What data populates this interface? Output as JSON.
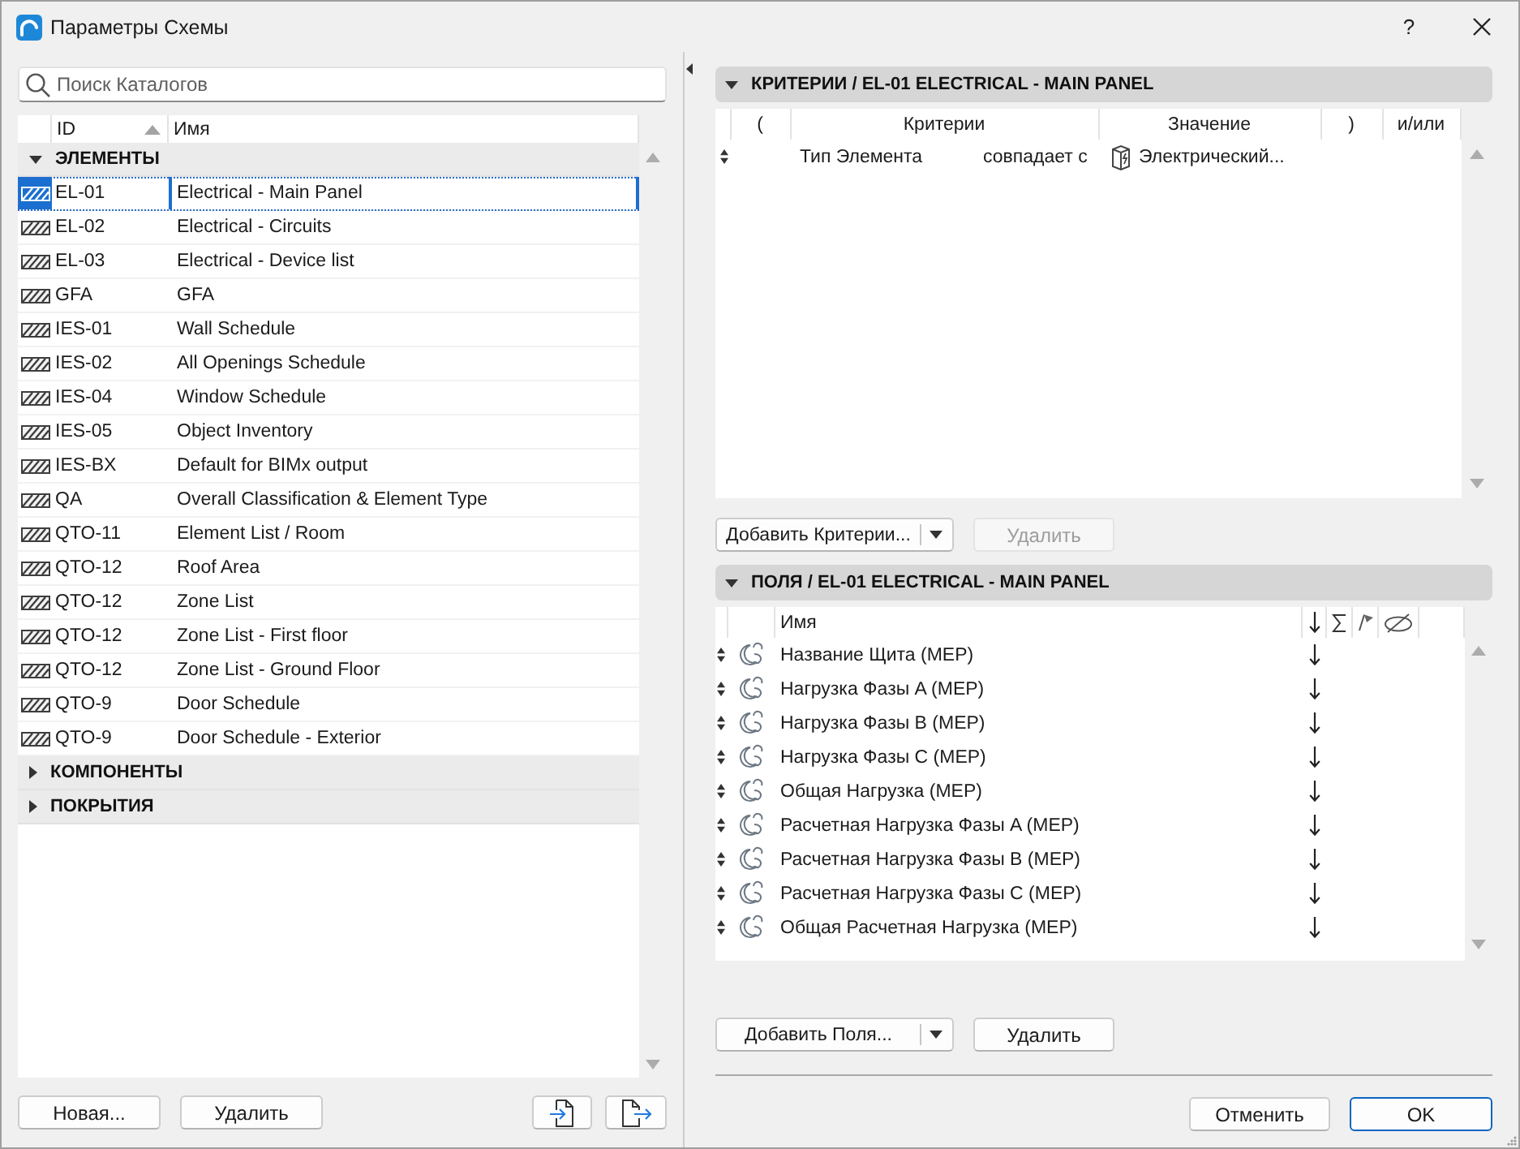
{
  "window": {
    "title": "Параметры Схемы",
    "help_button": "?"
  },
  "catalog": {
    "search": {
      "placeholder": "Поиск Каталогов"
    },
    "columns": [
      {
        "label": "ID",
        "sorted": true
      },
      {
        "label": "Имя",
        "sorted": false
      }
    ],
    "groups": [
      {
        "label": "ЭЛЕМЕНТЫ",
        "expanded": true,
        "items": [
          {
            "id": "EL-01",
            "name": "Electrical - Main Panel",
            "selected": true
          },
          {
            "id": "EL-02",
            "name": "Electrical - Circuits",
            "selected": false
          },
          {
            "id": "EL-03",
            "name": "Electrical - Device list",
            "selected": false
          },
          {
            "id": "GFA",
            "name": "GFA",
            "selected": false
          },
          {
            "id": "IES-01",
            "name": "Wall Schedule",
            "selected": false
          },
          {
            "id": "IES-02",
            "name": "All Openings Schedule",
            "selected": false
          },
          {
            "id": "IES-04",
            "name": "Window Schedule",
            "selected": false
          },
          {
            "id": "IES-05",
            "name": "Object Inventory",
            "selected": false
          },
          {
            "id": "IES-BX",
            "name": "Default for BIMx output",
            "selected": false
          },
          {
            "id": "QA",
            "name": "Overall Classification & Element Type",
            "selected": false
          },
          {
            "id": "QTO-11",
            "name": "Element List / Room",
            "selected": false
          },
          {
            "id": "QTO-12",
            "name": "Roof Area",
            "selected": false
          },
          {
            "id": "QTO-12",
            "name": "Zone List",
            "selected": false
          },
          {
            "id": "QTO-12",
            "name": "Zone List - First floor",
            "selected": false
          },
          {
            "id": "QTO-12",
            "name": "Zone List - Ground Floor",
            "selected": false
          },
          {
            "id": "QTO-9",
            "name": "Door Schedule",
            "selected": false
          },
          {
            "id": "QTO-9",
            "name": "Door Schedule - Exterior",
            "selected": false
          }
        ]
      },
      {
        "label": "КОМПОНЕНТЫ",
        "expanded": false
      },
      {
        "label": "ПОКРЫТИЯ",
        "expanded": false
      }
    ],
    "new_button": "Новая...",
    "delete_button": "Удалить"
  },
  "criteria": {
    "title": "КРИТЕРИИ / EL-01 ELECTRICAL - MAIN PANEL",
    "expanded": true,
    "columns": [
      "(",
      "Критерии",
      "Значение",
      ")",
      "и/или"
    ],
    "rows": [
      {
        "parameter": "Тип Элемента",
        "operator": "совпадает с",
        "value": "Электрический..."
      }
    ],
    "add_button": "Добавить Критерии...",
    "delete_button": {
      "label": "Удалить",
      "disabled": true
    }
  },
  "fields": {
    "title": "ПОЛЯ / EL-01 ELECTRICAL - MAIN PANEL",
    "expanded": true,
    "name_column": "Имя",
    "rows": [
      {
        "name": "Название Щита (MEP)",
        "sorted": true
      },
      {
        "name": "Нагрузка Фазы A (MEP)",
        "sorted": true
      },
      {
        "name": "Нагрузка Фазы B (MEP)",
        "sorted": true
      },
      {
        "name": "Нагрузка Фазы C (MEP)",
        "sorted": true
      },
      {
        "name": "Общая Нагрузка (MEP)",
        "sorted": true
      },
      {
        "name": "Расчетная Нагрузка Фазы A (MEP)",
        "sorted": true
      },
      {
        "name": "Расчетная Нагрузка Фазы B (MEP)",
        "sorted": true
      },
      {
        "name": "Расчетная Нагрузка Фазы C (MEP)",
        "sorted": true
      },
      {
        "name": "Общая Расчетная Нагрузка (MEP)",
        "sorted": true
      }
    ],
    "add_button": "Добавить Поля...",
    "delete_button": {
      "label": "Удалить",
      "disabled": false
    }
  },
  "footer": {
    "cancel_button": "Отменить",
    "ok_button": {
      "label": "OK",
      "default": true
    }
  }
}
